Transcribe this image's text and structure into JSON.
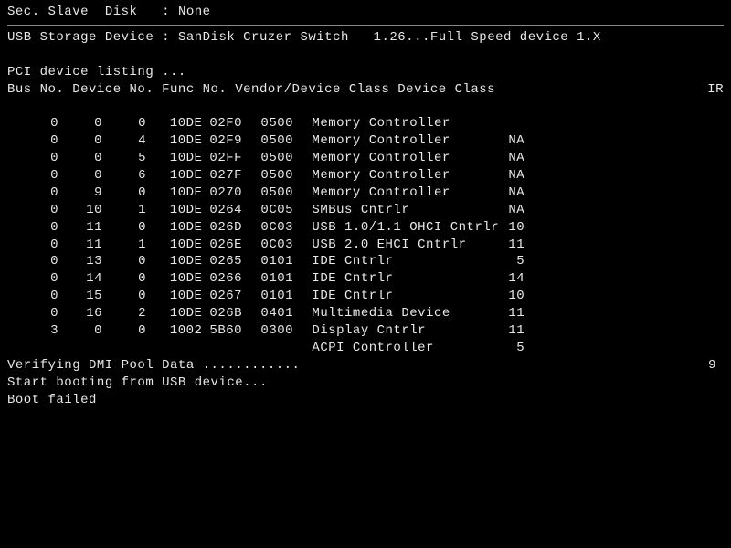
{
  "header": {
    "sec_slave_label": "Sec. Slave  Disk   : ",
    "sec_slave_value": "None",
    "usb_storage_label": "USB Storage Device : ",
    "usb_storage_value": "SanDisk Cruzer Switch   1.26...Full Speed device 1.X",
    "pci_listing": "PCI device listing ...",
    "columns": "Bus No. Device No. Func No. Vendor/Device Class Device Class",
    "irq_col": "IR"
  },
  "devices": [
    {
      "bus": "0",
      "dev": "0",
      "func": "0",
      "vendor": "10DE",
      "device": "02F0",
      "cls": "0500",
      "desc": "Memory Controller",
      "irq": ""
    },
    {
      "bus": "0",
      "dev": "0",
      "func": "4",
      "vendor": "10DE",
      "device": "02F9",
      "cls": "0500",
      "desc": "Memory Controller",
      "irq": "NA"
    },
    {
      "bus": "0",
      "dev": "0",
      "func": "5",
      "vendor": "10DE",
      "device": "02FF",
      "cls": "0500",
      "desc": "Memory Controller",
      "irq": "NA"
    },
    {
      "bus": "0",
      "dev": "0",
      "func": "6",
      "vendor": "10DE",
      "device": "027F",
      "cls": "0500",
      "desc": "Memory Controller",
      "irq": "NA"
    },
    {
      "bus": "0",
      "dev": "9",
      "func": "0",
      "vendor": "10DE",
      "device": "0270",
      "cls": "0500",
      "desc": "Memory Controller",
      "irq": "NA"
    },
    {
      "bus": "0",
      "dev": "10",
      "func": "1",
      "vendor": "10DE",
      "device": "0264",
      "cls": "0C05",
      "desc": "SMBus Cntrlr",
      "irq": "NA"
    },
    {
      "bus": "0",
      "dev": "11",
      "func": "0",
      "vendor": "10DE",
      "device": "026D",
      "cls": "0C03",
      "desc": "USB 1.0/1.1 OHCI Cntrlr",
      "irq": "10"
    },
    {
      "bus": "0",
      "dev": "11",
      "func": "1",
      "vendor": "10DE",
      "device": "026E",
      "cls": "0C03",
      "desc": "USB 2.0 EHCI Cntrlr",
      "irq": "11"
    },
    {
      "bus": "0",
      "dev": "13",
      "func": "0",
      "vendor": "10DE",
      "device": "0265",
      "cls": "0101",
      "desc": "IDE Cntrlr",
      "irq": "5"
    },
    {
      "bus": "0",
      "dev": "14",
      "func": "0",
      "vendor": "10DE",
      "device": "0266",
      "cls": "0101",
      "desc": "IDE Cntrlr",
      "irq": "14"
    },
    {
      "bus": "0",
      "dev": "15",
      "func": "0",
      "vendor": "10DE",
      "device": "0267",
      "cls": "0101",
      "desc": "IDE Cntrlr",
      "irq": "10"
    },
    {
      "bus": "0",
      "dev": "16",
      "func": "2",
      "vendor": "10DE",
      "device": "026B",
      "cls": "0401",
      "desc": "Multimedia Device",
      "irq": "11"
    },
    {
      "bus": "3",
      "dev": "0",
      "func": "0",
      "vendor": "1002",
      "device": "5B60",
      "cls": "0300",
      "desc": "Display Cntrlr",
      "irq": "11"
    },
    {
      "bus": "",
      "dev": "",
      "func": "",
      "vendor": "",
      "device": "",
      "cls": "",
      "desc": "ACPI Controller",
      "irq": "5"
    }
  ],
  "footer": {
    "dmi": "Verifying DMI Pool Data ............",
    "boot_start": "Start booting from USB device...",
    "boot_failed": "Boot failed",
    "trailing_irq": "9"
  }
}
